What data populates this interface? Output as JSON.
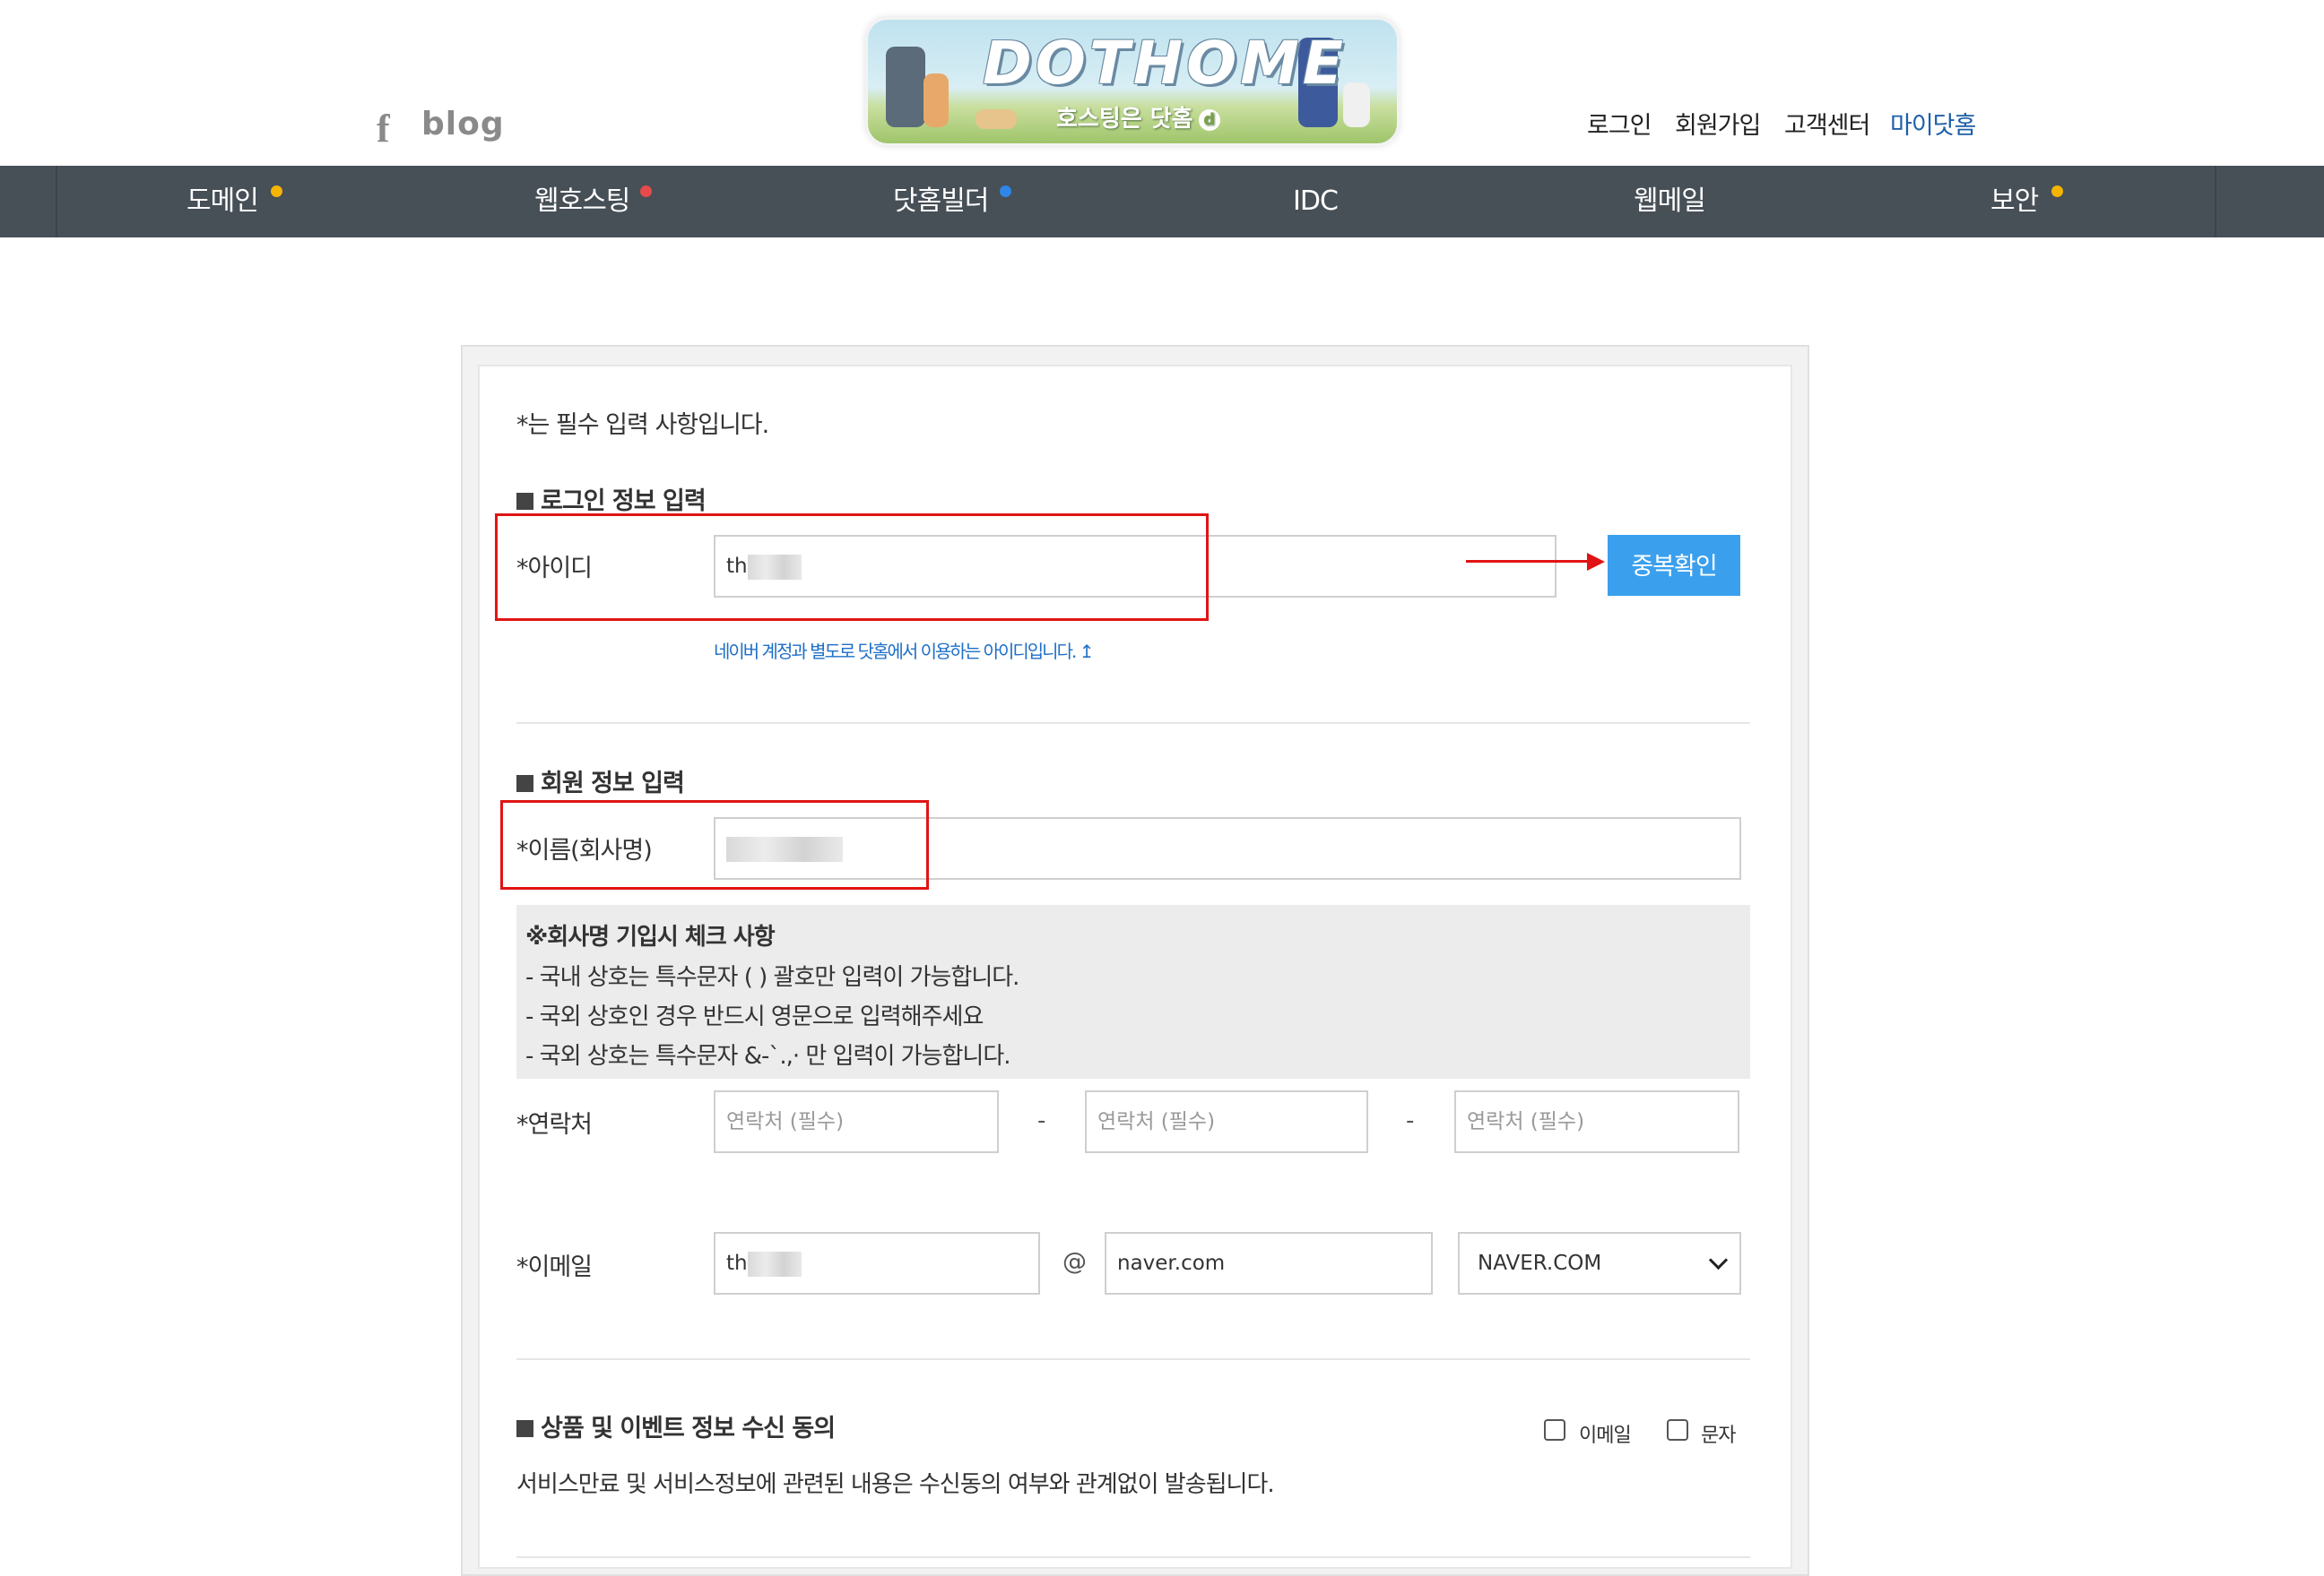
{
  "header": {
    "facebook_icon": "f",
    "blog_label": "blog",
    "logo": {
      "title": "DOTHOME",
      "subtitle": "호스팅은 닷홈",
      "subtitle_mark": "d"
    },
    "links": {
      "login": "로그인",
      "signup": "회원가입",
      "support": "고객센터",
      "my_dothome": "마이닷홈"
    }
  },
  "nav": {
    "items": [
      {
        "label": "도메인",
        "dot_color": "#f5b400"
      },
      {
        "label": "웹호스팅",
        "dot_color": "#e84a4a"
      },
      {
        "label": "닷홈빌더",
        "dot_color": "#2f86e6"
      },
      {
        "label": "IDC",
        "dot_color": ""
      },
      {
        "label": "웹메일",
        "dot_color": ""
      },
      {
        "label": "보안",
        "dot_color": "#f5b400"
      }
    ]
  },
  "form": {
    "required_note": "*는 필수 입력 사항입니다.",
    "login_section": {
      "title": "로그인 정보 입력",
      "id_label": "*아이디",
      "id_value": "th",
      "dup_check_button": "중복확인",
      "id_hint": "네이버 계정과 별도로 닷홈에서 이용하는 아이디입니다. ↥"
    },
    "member_section": {
      "title": "회원 정보 입력",
      "name_label": "*이름(회사명)",
      "notice": {
        "title": "※회사명 기입시 체크 사항",
        "lines": [
          "- 국내 상호는 특수문자 ( ) 괄호만 입력이 가능합니다.",
          "- 국외 상호인 경우 반드시 영문으로 입력해주세요",
          "- 국외 상호는 특수문자 &-`.,· 만 입력이 가능합니다."
        ]
      },
      "contact_label": "*연락처",
      "contact_placeholder": "연락처 (필수)",
      "contact_separator": "-",
      "email_label": "*이메일",
      "email_local_value": "th",
      "email_at": "@",
      "email_domain_value": "naver.com",
      "email_domain_select": "NAVER.COM"
    },
    "consent_section": {
      "title": "상품 및 이벤트 정보 수신 동의",
      "email_option": "이메일",
      "sms_option": "문자",
      "description": "서비스만료 및 서비스정보에 관련된 내용은 수신동의 여부와 관계없이 발송됩니다."
    }
  },
  "colors": {
    "nav_bg": "#474f57",
    "button_blue": "#3aa0ee",
    "hint_blue": "#1e6fc7",
    "annotation_red": "#e01414"
  }
}
